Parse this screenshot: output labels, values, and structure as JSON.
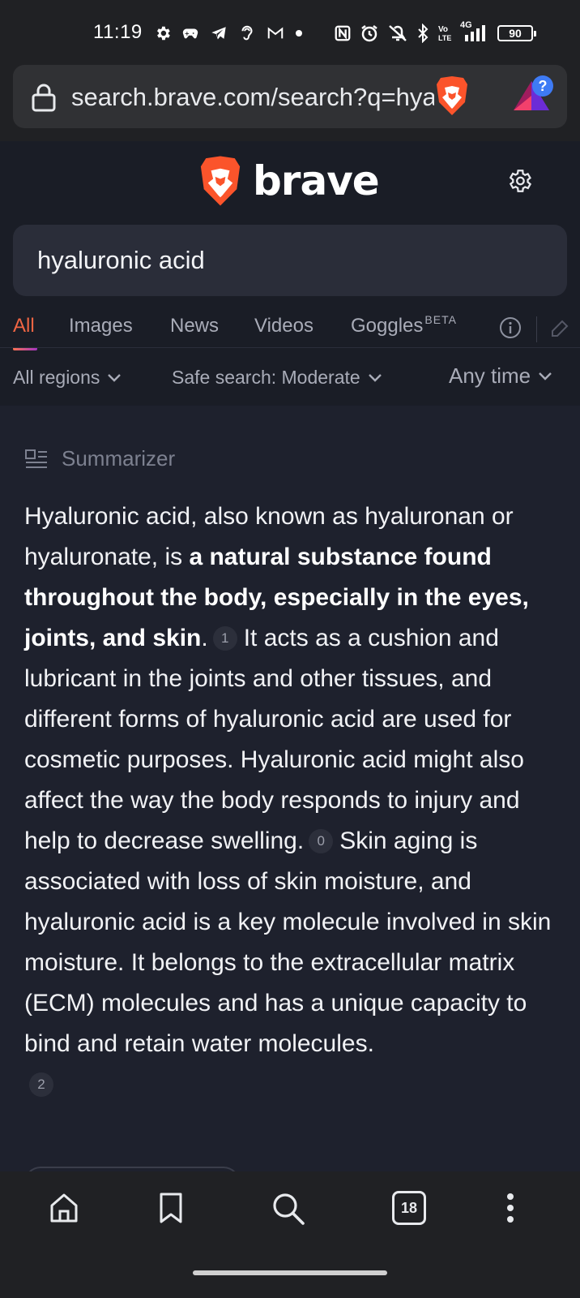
{
  "status_bar": {
    "time": "11:19",
    "network": "4G",
    "battery": "90",
    "icons": [
      "gear-icon",
      "game-controller-icon",
      "telegram-icon",
      "ear-icon",
      "gmail-icon",
      "dot-icon",
      "nfc-icon",
      "alarm-icon",
      "mute-icon",
      "bluetooth-icon",
      "volte-icon",
      "signal-icon",
      "battery-icon"
    ]
  },
  "browser": {
    "url": "search.brave.com/search?q=hyaluronic+acid",
    "icons": [
      "lock-icon",
      "brave-shield-icon",
      "brave-rewards-icon"
    ]
  },
  "header": {
    "logo_text": "brave",
    "search_query": "hyaluronic acid"
  },
  "tabs": [
    {
      "label": "All",
      "active": true
    },
    {
      "label": "Images"
    },
    {
      "label": "News"
    },
    {
      "label": "Videos"
    },
    {
      "label": "Goggles",
      "sup": "BETA"
    }
  ],
  "filters": {
    "region": "All regions",
    "safe_search": "Safe search: Moderate",
    "time": "Any time"
  },
  "summarizer": {
    "title": "Summarizer",
    "p1": "Hyaluronic acid, also known as hyaluronan or hyaluronate, is ",
    "p1_bold": "a natural substance found throughout the body, especially in the eyes, joints, and skin",
    "p1_end": ".",
    "cite1": "1",
    "p2": "It acts as a cushion and lubricant in the joints and other tissues, and different forms of hyaluronic acid are used for cosmetic purposes. Hyaluronic acid might also affect the way the body responds to injury and help to decrease swelling.",
    "cite2": "0",
    "p3": "Skin aging is associated with loss of skin moisture, and hyaluronic acid is a key molecule involved in skin moisture. It belongs to the extracellular matrix (ECM) molecules and has a unique capacity to bind and retain water molecules.",
    "cite3": "2"
  },
  "bottom_nav": {
    "tab_count": "18",
    "icons": [
      "home-icon",
      "bookmark-icon",
      "search-icon",
      "tabs-icon",
      "more-icon"
    ]
  },
  "colors": {
    "accent": "#f06543",
    "brave_orange": "#fb542b",
    "background": "#1e212d"
  }
}
